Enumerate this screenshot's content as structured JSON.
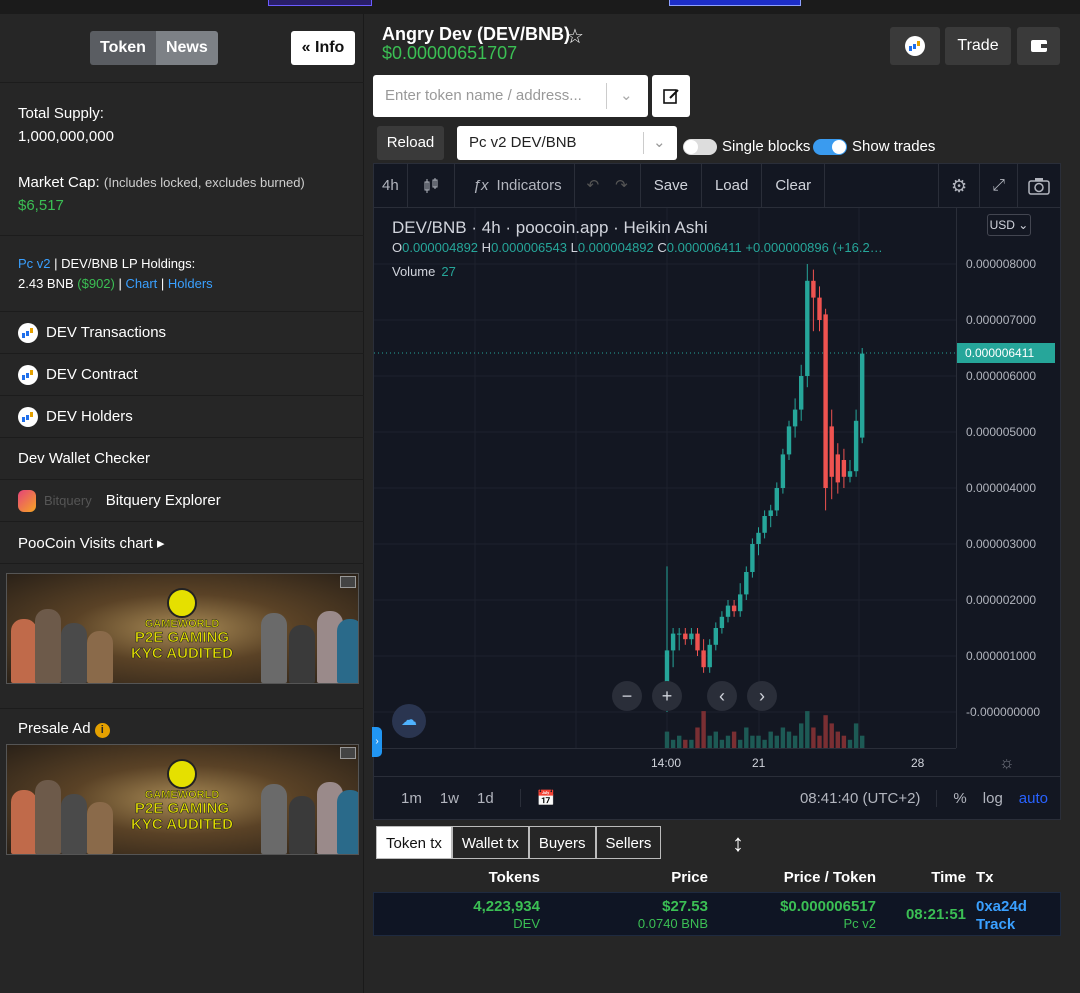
{
  "sidebar": {
    "tabs": [
      "Token",
      "News"
    ],
    "info_label": "« Info",
    "total_supply_label": "Total Supply:",
    "total_supply_value": "1,000,000,000",
    "market_cap_label": "Market Cap:",
    "market_cap_note": "(Includes locked, excludes burned)",
    "market_cap_value": "$6,517",
    "lp_prefix": "Pc v2",
    "lp_text": " | DEV/BNB LP Holdings:",
    "lp_bnb": "2.43 BNB",
    "lp_usd": "($902)",
    "lp_chart": "Chart",
    "lp_holders": "Holders",
    "menu": [
      "DEV Transactions",
      "DEV Contract",
      "DEV Holders",
      "Dev Wallet Checker",
      "Bitquery Explorer",
      "PooCoin Visits chart ▸"
    ],
    "bitquery_word": "Bitquery",
    "presale_label": "Presale Ad",
    "ad": {
      "title": "GAMEWORLD",
      "line1": "P2E GAMING",
      "line2": "KYC AUDITED"
    }
  },
  "header": {
    "title": "Angry Dev (DEV/BNB)",
    "price": "$0.00000651707",
    "trade_label": "Trade",
    "search_placeholder": "Enter token name / address...",
    "reload_label": "Reload",
    "pair_select": "Pc v2 DEV/BNB",
    "single_blocks_label": "Single blocks",
    "show_trades_label": "Show trades"
  },
  "chart_toolbar": {
    "interval": "4h",
    "indicators": "Indicators",
    "save": "Save",
    "load": "Load",
    "clear": "Clear"
  },
  "chart_legend": {
    "symbol": "DEV/BNB · 4h · poocoin.app · Heikin Ashi",
    "o_label": "O",
    "o": "0.000004892",
    "h_label": "H",
    "h": "0.000006543",
    "l_label": "L",
    "l": "0.000004892",
    "c_label": "C",
    "c": "0.000006411",
    "change": "+0.000000896 (+16.2…",
    "volume_label": "Volume",
    "volume_value": "27",
    "currency": "USD"
  },
  "chart_footer": {
    "ranges": [
      "1m",
      "1w",
      "1d"
    ],
    "clock": "08:41:40 (UTC+2)",
    "pct": "%",
    "log": "log",
    "auto": "auto"
  },
  "chart_data": {
    "type": "candlestick",
    "title": "DEV/BNB · 4h · poocoin.app · Heikin Ashi",
    "y_ticks": [
      "0.000008000",
      "0.000007000",
      "0.000006000",
      "0.000005000",
      "0.000004000",
      "0.000003000",
      "0.000002000",
      "0.000001000",
      "-0.000000000"
    ],
    "last_price": "0.000006411",
    "x_ticks": [
      "14:00",
      "21",
      "28"
    ],
    "ylim": [
      0,
      8.2e-06
    ],
    "series": [
      {
        "o": 3e-07,
        "h": 2.6e-06,
        "l": 0.0,
        "c": 1.1e-06
      },
      {
        "o": 1.1e-06,
        "h": 1.5e-06,
        "l": 8e-07,
        "c": 1.4e-06
      },
      {
        "o": 1.4e-06,
        "h": 1.5e-06,
        "l": 1.1e-06,
        "c": 1.4e-06
      },
      {
        "o": 1.4e-06,
        "h": 1.5e-06,
        "l": 1.2e-06,
        "c": 1.3e-06
      },
      {
        "o": 1.3e-06,
        "h": 1.5e-06,
        "l": 1.2e-06,
        "c": 1.4e-06
      },
      {
        "o": 1.4e-06,
        "h": 1.5e-06,
        "l": 1e-06,
        "c": 1.1e-06
      },
      {
        "o": 1.1e-06,
        "h": 1.3e-06,
        "l": 7e-07,
        "c": 8e-07
      },
      {
        "o": 8e-07,
        "h": 1.3e-06,
        "l": 7e-07,
        "c": 1.2e-06
      },
      {
        "o": 1.2e-06,
        "h": 1.6e-06,
        "l": 1.1e-06,
        "c": 1.5e-06
      },
      {
        "o": 1.5e-06,
        "h": 1.8e-06,
        "l": 1.4e-06,
        "c": 1.7e-06
      },
      {
        "o": 1.7e-06,
        "h": 2e-06,
        "l": 1.6e-06,
        "c": 1.9e-06
      },
      {
        "o": 1.9e-06,
        "h": 2e-06,
        "l": 1.7e-06,
        "c": 1.8e-06
      },
      {
        "o": 1.8e-06,
        "h": 2.3e-06,
        "l": 1.7e-06,
        "c": 2.1e-06
      },
      {
        "o": 2.1e-06,
        "h": 2.6e-06,
        "l": 2e-06,
        "c": 2.5e-06
      },
      {
        "o": 2.5e-06,
        "h": 3.1e-06,
        "l": 2.4e-06,
        "c": 3e-06
      },
      {
        "o": 3e-06,
        "h": 3.3e-06,
        "l": 2.8e-06,
        "c": 3.2e-06
      },
      {
        "o": 3.2e-06,
        "h": 3.6e-06,
        "l": 3.1e-06,
        "c": 3.5e-06
      },
      {
        "o": 3.5e-06,
        "h": 3.7e-06,
        "l": 3.3e-06,
        "c": 3.6e-06
      },
      {
        "o": 3.6e-06,
        "h": 4.1e-06,
        "l": 3.5e-06,
        "c": 4e-06
      },
      {
        "o": 4e-06,
        "h": 4.7e-06,
        "l": 3.9e-06,
        "c": 4.6e-06
      },
      {
        "o": 4.6e-06,
        "h": 5.2e-06,
        "l": 4.5e-06,
        "c": 5.1e-06
      },
      {
        "o": 5.1e-06,
        "h": 5.6e-06,
        "l": 4.9e-06,
        "c": 5.4e-06
      },
      {
        "o": 5.4e-06,
        "h": 6.2e-06,
        "l": 5.2e-06,
        "c": 6e-06
      },
      {
        "o": 6e-06,
        "h": 8e-06,
        "l": 5.8e-06,
        "c": 7.7e-06
      },
      {
        "o": 7.7e-06,
        "h": 7.9e-06,
        "l": 6.8e-06,
        "c": 7.4e-06
      },
      {
        "o": 7.4e-06,
        "h": 7.6e-06,
        "l": 6.8e-06,
        "c": 7e-06
      },
      {
        "o": 7.1e-06,
        "h": 7.2e-06,
        "l": 3.6e-06,
        "c": 4e-06
      },
      {
        "o": 5.1e-06,
        "h": 5.4e-06,
        "l": 3.8e-06,
        "c": 4.2e-06
      },
      {
        "o": 4.6e-06,
        "h": 4.8e-06,
        "l": 3.9e-06,
        "c": 4.1e-06
      },
      {
        "o": 4.5e-06,
        "h": 4.7e-06,
        "l": 4e-06,
        "c": 4.2e-06
      },
      {
        "o": 4.2e-06,
        "h": 4.5e-06,
        "l": 4.1e-06,
        "c": 4.3e-06
      },
      {
        "o": 4.3e-06,
        "h": 5.4e-06,
        "l": 4.2e-06,
        "c": 5.2e-06
      },
      {
        "o": 4.9e-06,
        "h": 6.5e-06,
        "l": 4.8e-06,
        "c": 6.4e-06
      }
    ],
    "volumes": [
      4,
      2,
      3,
      2,
      2,
      5,
      9,
      3,
      4,
      2,
      3,
      4,
      2,
      5,
      3,
      3,
      2,
      4,
      3,
      5,
      4,
      3,
      6,
      9,
      5,
      3,
      8,
      6,
      4,
      3,
      2,
      6,
      3
    ]
  },
  "colors": {
    "up": "#26a69a",
    "down": "#ef5350",
    "accent_green": "#3bbf54",
    "link": "#3aa0ff"
  },
  "trades": {
    "tabs": [
      "Token tx",
      "Wallet tx",
      "Buyers",
      "Sellers"
    ],
    "headers": [
      "Tokens",
      "Price",
      "Price / Token",
      "Time",
      "Tx"
    ],
    "row": {
      "tokens": "4,223,934",
      "tokens_unit": "DEV",
      "price": "$27.53",
      "price_bnb": "0.0740 BNB",
      "price_token": "$0.000006517",
      "pool": "Pc v2",
      "time": "08:21:51",
      "tx": "0xa24d",
      "track": "Track"
    }
  }
}
